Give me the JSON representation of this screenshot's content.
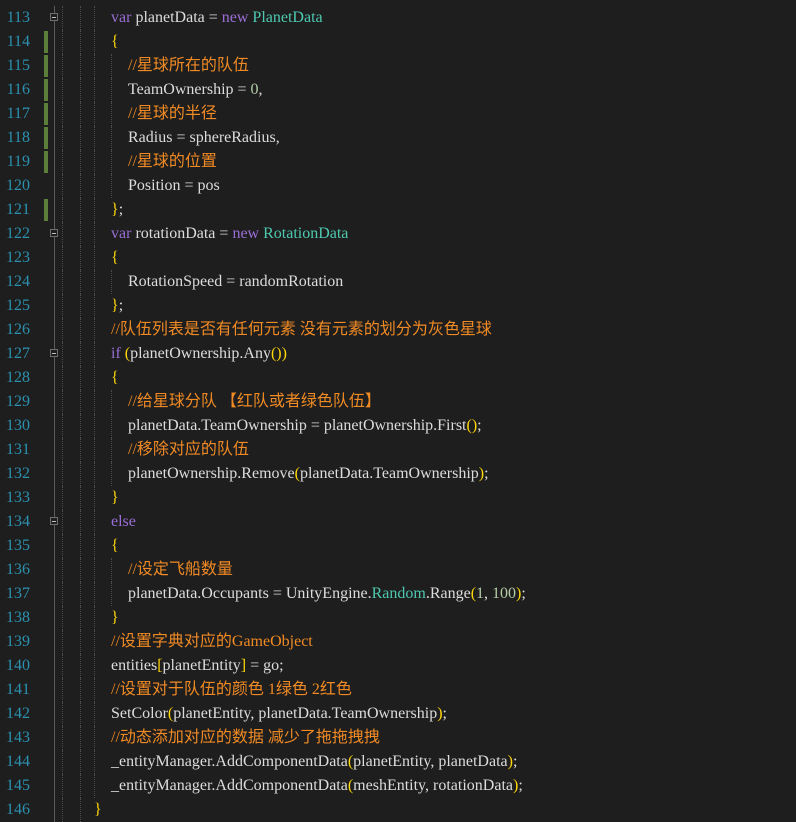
{
  "colors": {
    "background": "#1e1e1e",
    "line_number": "#2b91af",
    "keyword": "#9a6ed6",
    "type": "#4ec9b0",
    "comment": "#f08a24",
    "plain": "#dcdcdc",
    "brace": "#ffd70a",
    "modified_marker": "#5b7f3a"
  },
  "lines": [
    {
      "num": "113",
      "indent": 1,
      "fold": true,
      "mod": false,
      "tokens": [
        {
          "k": "keyword",
          "t": "var"
        },
        {
          "k": "plain",
          "t": " planetData "
        },
        {
          "k": "punct",
          "t": "="
        },
        {
          "k": "plain",
          "t": " "
        },
        {
          "k": "keyword",
          "t": "new"
        },
        {
          "k": "plain",
          "t": " "
        },
        {
          "k": "type",
          "t": "PlanetData"
        }
      ]
    },
    {
      "num": "114",
      "indent": 1,
      "fold": false,
      "mod": true,
      "tokens": [
        {
          "k": "brace",
          "t": "{"
        }
      ]
    },
    {
      "num": "115",
      "indent": 2,
      "fold": false,
      "mod": true,
      "tokens": [
        {
          "k": "comment",
          "t": "//星球所在的队伍"
        }
      ]
    },
    {
      "num": "116",
      "indent": 2,
      "fold": false,
      "mod": true,
      "tokens": [
        {
          "k": "plain",
          "t": "TeamOwnership "
        },
        {
          "k": "punct",
          "t": "="
        },
        {
          "k": "plain",
          "t": " "
        },
        {
          "k": "number",
          "t": "0"
        },
        {
          "k": "punct",
          "t": ","
        }
      ]
    },
    {
      "num": "117",
      "indent": 2,
      "fold": false,
      "mod": true,
      "tokens": [
        {
          "k": "comment",
          "t": "//星球的半径"
        }
      ]
    },
    {
      "num": "118",
      "indent": 2,
      "fold": false,
      "mod": true,
      "tokens": [
        {
          "k": "plain",
          "t": "Radius "
        },
        {
          "k": "punct",
          "t": "="
        },
        {
          "k": "plain",
          "t": " sphereRadius"
        },
        {
          "k": "punct",
          "t": ","
        }
      ]
    },
    {
      "num": "119",
      "indent": 2,
      "fold": false,
      "mod": true,
      "tokens": [
        {
          "k": "comment",
          "t": "//星球的位置"
        }
      ]
    },
    {
      "num": "120",
      "indent": 2,
      "fold": false,
      "mod": false,
      "tokens": [
        {
          "k": "plain",
          "t": "Position "
        },
        {
          "k": "punct",
          "t": "="
        },
        {
          "k": "plain",
          "t": " pos"
        }
      ]
    },
    {
      "num": "121",
      "indent": 1,
      "fold": false,
      "mod": true,
      "tokens": [
        {
          "k": "brace",
          "t": "}"
        },
        {
          "k": "punct",
          "t": ";"
        }
      ]
    },
    {
      "num": "122",
      "indent": 1,
      "fold": true,
      "mod": false,
      "tokens": [
        {
          "k": "keyword",
          "t": "var"
        },
        {
          "k": "plain",
          "t": " rotationData "
        },
        {
          "k": "punct",
          "t": "="
        },
        {
          "k": "plain",
          "t": " "
        },
        {
          "k": "keyword",
          "t": "new"
        },
        {
          "k": "plain",
          "t": " "
        },
        {
          "k": "type",
          "t": "RotationData"
        }
      ]
    },
    {
      "num": "123",
      "indent": 1,
      "fold": false,
      "mod": false,
      "tokens": [
        {
          "k": "brace",
          "t": "{"
        }
      ]
    },
    {
      "num": "124",
      "indent": 2,
      "fold": false,
      "mod": false,
      "tokens": [
        {
          "k": "plain",
          "t": "RotationSpeed "
        },
        {
          "k": "punct",
          "t": "="
        },
        {
          "k": "plain",
          "t": " randomRotation"
        }
      ]
    },
    {
      "num": "125",
      "indent": 1,
      "fold": false,
      "mod": false,
      "tokens": [
        {
          "k": "brace",
          "t": "}"
        },
        {
          "k": "punct",
          "t": ";"
        }
      ]
    },
    {
      "num": "126",
      "indent": 1,
      "fold": false,
      "mod": false,
      "tokens": [
        {
          "k": "comment",
          "t": "//队伍列表是否有任何元素 没有元素的划分为灰色星球"
        }
      ]
    },
    {
      "num": "127",
      "indent": 1,
      "fold": true,
      "mod": false,
      "tokens": [
        {
          "k": "keyword",
          "t": "if"
        },
        {
          "k": "plain",
          "t": " "
        },
        {
          "k": "paren",
          "t": "("
        },
        {
          "k": "plain",
          "t": "planetOwnership.Any"
        },
        {
          "k": "paren",
          "t": "())"
        }
      ]
    },
    {
      "num": "128",
      "indent": 1,
      "fold": false,
      "mod": false,
      "tokens": [
        {
          "k": "brace",
          "t": "{"
        }
      ]
    },
    {
      "num": "129",
      "indent": 2,
      "fold": false,
      "mod": false,
      "tokens": [
        {
          "k": "comment",
          "t": "//给星球分队 【红队或者绿色队伍】"
        }
      ]
    },
    {
      "num": "130",
      "indent": 2,
      "fold": false,
      "mod": false,
      "tokens": [
        {
          "k": "plain",
          "t": "planetData.TeamOwnership "
        },
        {
          "k": "punct",
          "t": "="
        },
        {
          "k": "plain",
          "t": " planetOwnership.First"
        },
        {
          "k": "paren",
          "t": "()"
        },
        {
          "k": "punct",
          "t": ";"
        }
      ]
    },
    {
      "num": "131",
      "indent": 2,
      "fold": false,
      "mod": false,
      "tokens": [
        {
          "k": "comment",
          "t": "//移除对应的队伍"
        }
      ]
    },
    {
      "num": "132",
      "indent": 2,
      "fold": false,
      "mod": false,
      "tokens": [
        {
          "k": "plain",
          "t": "planetOwnership.Remove"
        },
        {
          "k": "paren",
          "t": "("
        },
        {
          "k": "plain",
          "t": "planetData.TeamOwnership"
        },
        {
          "k": "paren",
          "t": ")"
        },
        {
          "k": "punct",
          "t": ";"
        }
      ]
    },
    {
      "num": "133",
      "indent": 1,
      "fold": false,
      "mod": false,
      "tokens": [
        {
          "k": "brace",
          "t": "}"
        }
      ]
    },
    {
      "num": "134",
      "indent": 1,
      "fold": true,
      "mod": false,
      "tokens": [
        {
          "k": "keyword",
          "t": "else"
        }
      ]
    },
    {
      "num": "135",
      "indent": 1,
      "fold": false,
      "mod": false,
      "tokens": [
        {
          "k": "brace",
          "t": "{"
        }
      ]
    },
    {
      "num": "136",
      "indent": 2,
      "fold": false,
      "mod": false,
      "tokens": [
        {
          "k": "comment",
          "t": "//设定飞船数量"
        }
      ]
    },
    {
      "num": "137",
      "indent": 2,
      "fold": false,
      "mod": false,
      "tokens": [
        {
          "k": "plain",
          "t": "planetData.Occupants "
        },
        {
          "k": "punct",
          "t": "="
        },
        {
          "k": "plain",
          "t": " UnityEngine."
        },
        {
          "k": "type",
          "t": "Random"
        },
        {
          "k": "plain",
          "t": ".Range"
        },
        {
          "k": "paren",
          "t": "("
        },
        {
          "k": "number",
          "t": "1"
        },
        {
          "k": "punct",
          "t": ", "
        },
        {
          "k": "number",
          "t": "100"
        },
        {
          "k": "paren",
          "t": ")"
        },
        {
          "k": "punct",
          "t": ";"
        }
      ]
    },
    {
      "num": "138",
      "indent": 1,
      "fold": false,
      "mod": false,
      "tokens": [
        {
          "k": "brace",
          "t": "}"
        }
      ]
    },
    {
      "num": "139",
      "indent": 1,
      "fold": false,
      "mod": false,
      "tokens": [
        {
          "k": "comment",
          "t": "//设置字典对应的GameObject"
        }
      ]
    },
    {
      "num": "140",
      "indent": 1,
      "fold": false,
      "mod": false,
      "tokens": [
        {
          "k": "plain",
          "t": "entities"
        },
        {
          "k": "paren",
          "t": "["
        },
        {
          "k": "plain",
          "t": "planetEntity"
        },
        {
          "k": "paren",
          "t": "]"
        },
        {
          "k": "plain",
          "t": " "
        },
        {
          "k": "punct",
          "t": "="
        },
        {
          "k": "plain",
          "t": " go"
        },
        {
          "k": "punct",
          "t": ";"
        }
      ]
    },
    {
      "num": "141",
      "indent": 1,
      "fold": false,
      "mod": false,
      "tokens": [
        {
          "k": "comment",
          "t": "//设置对于队伍的颜色 1绿色 2红色"
        }
      ]
    },
    {
      "num": "142",
      "indent": 1,
      "fold": false,
      "mod": false,
      "tokens": [
        {
          "k": "plain",
          "t": "SetColor"
        },
        {
          "k": "paren",
          "t": "("
        },
        {
          "k": "plain",
          "t": "planetEntity, planetData.TeamOwnership"
        },
        {
          "k": "paren",
          "t": ")"
        },
        {
          "k": "punct",
          "t": ";"
        }
      ]
    },
    {
      "num": "143",
      "indent": 1,
      "fold": false,
      "mod": false,
      "tokens": [
        {
          "k": "comment",
          "t": "//动态添加对应的数据 减少了拖拖拽拽"
        }
      ]
    },
    {
      "num": "144",
      "indent": 1,
      "fold": false,
      "mod": false,
      "tokens": [
        {
          "k": "plain",
          "t": "_entityManager.AddComponentData"
        },
        {
          "k": "paren",
          "t": "("
        },
        {
          "k": "plain",
          "t": "planetEntity, planetData"
        },
        {
          "k": "paren",
          "t": ")"
        },
        {
          "k": "punct",
          "t": ";"
        }
      ]
    },
    {
      "num": "145",
      "indent": 1,
      "fold": false,
      "mod": false,
      "tokens": [
        {
          "k": "plain",
          "t": "_entityManager.AddComponentData"
        },
        {
          "k": "paren",
          "t": "("
        },
        {
          "k": "plain",
          "t": "meshEntity, rotationData"
        },
        {
          "k": "paren",
          "t": ")"
        },
        {
          "k": "punct",
          "t": ";"
        }
      ]
    },
    {
      "num": "146",
      "indent": 0,
      "fold": false,
      "mod": false,
      "tokens": [
        {
          "k": "brace",
          "t": "}"
        }
      ]
    }
  ]
}
